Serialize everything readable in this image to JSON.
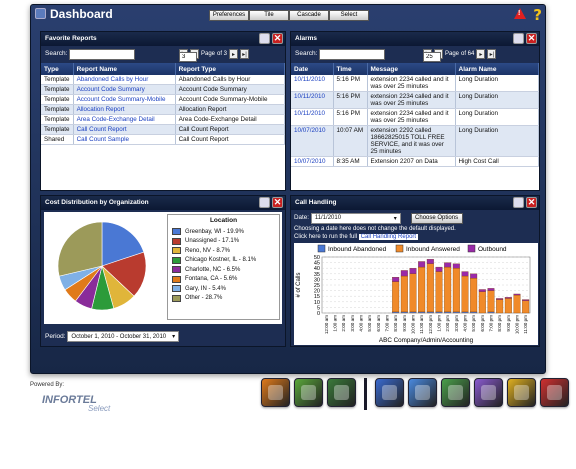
{
  "window": {
    "title": "Dashboard",
    "buttons": [
      "Preferences",
      "Tile",
      "Cascade",
      "Select"
    ]
  },
  "favorite_reports": {
    "title": "Favorite Reports",
    "search_label": "Search:",
    "search_value": "",
    "pager": {
      "page_label": "Page",
      "page": "3",
      "of_label": "of 3"
    },
    "columns": [
      "Type",
      "Report Name",
      "Report Type"
    ],
    "rows": [
      {
        "type": "Template",
        "name": "Abandoned Calls by Hour",
        "rtype": "Abandoned Calls by Hour"
      },
      {
        "type": "Template",
        "name": "Account Code Summary",
        "rtype": "Account Code Summary"
      },
      {
        "type": "Template",
        "name": "Account Code Summary-Mobile",
        "rtype": "Account Code Summary-Mobile"
      },
      {
        "type": "Template",
        "name": "Allocation Report",
        "rtype": "Allocation Report"
      },
      {
        "type": "Template",
        "name": "Area Code-Exchange Detail",
        "rtype": "Area Code-Exchange Detail"
      },
      {
        "type": "Template",
        "name": "Call Count Report",
        "rtype": "Call Count Report"
      },
      {
        "type": "Shared",
        "name": "Call Count Sample",
        "rtype": "Call Count Report"
      }
    ]
  },
  "alarms": {
    "title": "Alarms",
    "search_label": "Search:",
    "search_value": "",
    "pager": {
      "page_label": "Page",
      "page": "25",
      "of_label": "of 64"
    },
    "columns": [
      "Date",
      "Time",
      "Message",
      "Alarm Name"
    ],
    "rows": [
      {
        "date": "10/11/2010",
        "time": "5:16 PM",
        "message": "extension  2234 called and it was over 25 minutes",
        "name": "Long Duration"
      },
      {
        "date": "10/11/2010",
        "time": "5:16 PM",
        "message": "extension  2234 called and it was over 25 minutes",
        "name": "Long Duration"
      },
      {
        "date": "10/11/2010",
        "time": "5:16 PM",
        "message": "extension  2234 called and it was over 25 minutes",
        "name": "Long Duration"
      },
      {
        "date": "10/07/2010",
        "time": "10:07 AM",
        "message": "extension  2292 called 18662825015  TOLL FREE SERVICE,  and it was over 25 minutes",
        "name": "Long Duration"
      },
      {
        "date": "10/07/2010",
        "time": "8:35 AM",
        "message": "Extension 2207  on Data",
        "name": "High Cost Call"
      }
    ]
  },
  "cost_distribution": {
    "title": "Cost Distribution by Organization",
    "legend_title": "Location",
    "period_label": "Period:",
    "period_value": "October 1, 2010 - October 31, 2010",
    "slice_colors": [
      "#4a78d4",
      "#b93b2f",
      "#e0b53a",
      "#2c9b3a",
      "#8a2c9a",
      "#e07a1a",
      "#7fb0e6",
      "#9c9a5a"
    ]
  },
  "call_handling": {
    "title": "Call Handling",
    "date_label": "Date:",
    "date_value": "11/1/2010",
    "options_button": "Choose Options",
    "note": "Choosing a date here does not change the default displayed.",
    "click_text": "Click here to run the full",
    "link_text": "Call Handling Report",
    "caption": "ABC Company/Admin/Accounting"
  },
  "chart_data": [
    {
      "type": "pie",
      "title": "Location",
      "categories": [
        "Greenbay, WI - 19.9%",
        "Unassigned - 17.1%",
        "Reno, NV - 8.7%",
        "Chicago Kostner, IL - 8.1%",
        "Charlotte, NC - 6.5%",
        "Fontana, CA - 5.6%",
        "Gary, IN - 5.4%",
        "Other - 28.7%"
      ],
      "values": [
        19.9,
        17.1,
        8.7,
        8.1,
        6.5,
        5.6,
        5.4,
        28.7
      ]
    },
    {
      "type": "bar",
      "stacked": true,
      "legend": [
        "Inbound Abandoned",
        "Inbound Answered",
        "Outbound"
      ],
      "legend_colors": [
        "#4a78d4",
        "#f08a2a",
        "#9a2aa8"
      ],
      "ylabel": "# of Calls",
      "xlabel": "ABC Company/Admin/Accounting",
      "ylim": [
        0,
        50
      ],
      "yticks": [
        0,
        5,
        10,
        15,
        20,
        25,
        30,
        35,
        40,
        45,
        50
      ],
      "categories": [
        "12:00 am",
        "1:00 am",
        "2:00 am",
        "3:00 am",
        "4:00 am",
        "5:00 am",
        "6:00 am",
        "7:00 am",
        "8:00 am",
        "9:00 am",
        "10:00 am",
        "11:00 am",
        "12:00 pm",
        "1:00 pm",
        "2:00 pm",
        "3:00 pm",
        "4:00 pm",
        "5:00 pm",
        "6:00 pm",
        "7:00 pm",
        "8:00 pm",
        "9:00 pm",
        "10:00 pm",
        "11:00 pm"
      ],
      "series": [
        {
          "name": "Inbound Abandoned",
          "values": [
            0,
            0,
            0,
            0,
            0,
            0,
            0,
            0,
            1,
            1,
            1,
            1,
            1,
            1,
            1,
            1,
            1,
            1,
            0,
            1,
            0,
            0,
            0,
            0
          ]
        },
        {
          "name": "Inbound Answered",
          "values": [
            0,
            0,
            0,
            0,
            0,
            0,
            0,
            0,
            27,
            32,
            34,
            40,
            43,
            36,
            40,
            39,
            32,
            30,
            19,
            19,
            12,
            13,
            16,
            11
          ]
        },
        {
          "name": "Outbound",
          "values": [
            0,
            0,
            0,
            0,
            0,
            0,
            0,
            0,
            4,
            5,
            5,
            5,
            4,
            4,
            4,
            4,
            4,
            4,
            2,
            2,
            1,
            1,
            1,
            1
          ]
        }
      ]
    }
  ],
  "footer": {
    "powered_by": "Powered By:",
    "logo_main": "INFORTEL",
    "logo_sub": "Select"
  },
  "dock": {
    "colors": [
      "#e07a1a",
      "#5aa83a",
      "#3a7a3a",
      "#3a6ad0",
      "#4a8ae0",
      "#4aa04a",
      "#8a5ad0",
      "#e0b020",
      "#d03030"
    ],
    "icons": [
      "users-icon",
      "map-icon",
      "bar-chart-icon",
      "dashboard-icon",
      "gear-icon",
      "document-icon",
      "calendar-icon",
      "help-icon",
      "alert-icon"
    ]
  }
}
